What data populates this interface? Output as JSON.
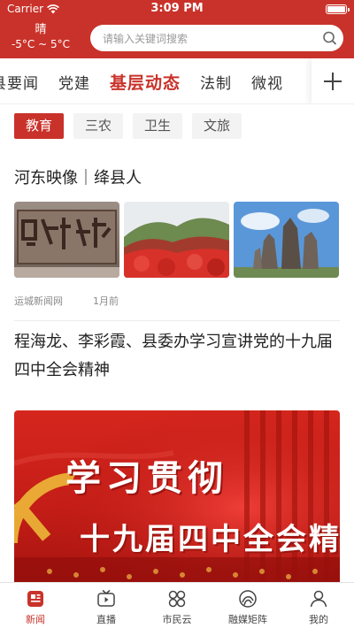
{
  "status_bar": {
    "carrier": "Carrier",
    "time": "3:09 PM"
  },
  "weather": {
    "condition": "晴",
    "temperature": "-5°C ~ 5°C"
  },
  "search": {
    "placeholder": "请输入关键词搜索",
    "icon": "search-icon"
  },
  "nav_tabs": [
    {
      "label": "县要闻",
      "active": false
    },
    {
      "label": "党建",
      "active": false
    },
    {
      "label": "基层动态",
      "active": true
    },
    {
      "label": "法制",
      "active": false
    },
    {
      "label": "微视",
      "active": false
    }
  ],
  "add_channel_icon": "plus-icon",
  "sub_categories": [
    {
      "label": "教育",
      "active": true
    },
    {
      "label": "三农",
      "active": false
    },
    {
      "label": "卫生",
      "active": false
    },
    {
      "label": "文旅",
      "active": false
    }
  ],
  "feed": [
    {
      "title": "河东映像｜绛县人",
      "source": "运城新闻网",
      "time": "1月前",
      "images": [
        "stone-inscription-photo",
        "red-autumn-mountain-photo",
        "statue-group-photo"
      ]
    },
    {
      "title": "程海龙、李彩霞、县委办学习宣讲党的十九届四中全会精神",
      "banner": {
        "line1": "学习贯彻",
        "line2": "十九届四中全会精神"
      }
    }
  ],
  "bottom_nav": [
    {
      "label": "新闻",
      "icon": "news-icon",
      "active": true
    },
    {
      "label": "直播",
      "icon": "live-tv-icon",
      "active": false
    },
    {
      "label": "市民云",
      "icon": "grid-circles-icon",
      "active": false
    },
    {
      "label": "融媒矩阵",
      "icon": "media-matrix-icon",
      "active": false
    },
    {
      "label": "我的",
      "icon": "user-icon",
      "active": false
    }
  ],
  "colors": {
    "brand_red": "#c9322a",
    "text_dark": "#222222",
    "text_muted": "#8a8a8a"
  }
}
